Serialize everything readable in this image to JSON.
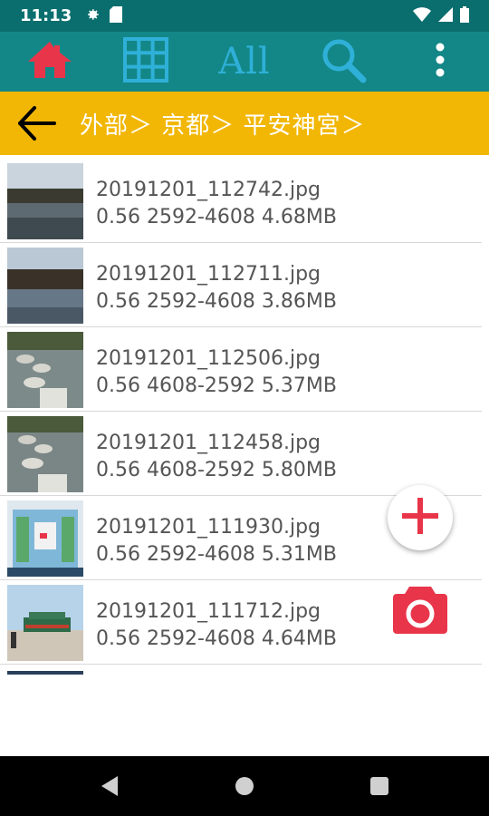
{
  "status": {
    "time": "11:13",
    "icons": [
      "gear-icon",
      "sd-card-icon",
      "wifi-icon",
      "signal-icon",
      "battery-icon"
    ]
  },
  "toolbar": {
    "home_icon": "home-icon",
    "grid_icon": "grid-icon",
    "all_label": "All",
    "search_icon": "search-icon",
    "menu_icon": "more-vert-icon"
  },
  "path": {
    "back_icon": "back-arrow-icon",
    "text": "外部＞ 京都＞ 平安神宮＞"
  },
  "files": [
    {
      "name": "20191201_112742.jpg",
      "info": "0.56 2592-4608  4.68MB"
    },
    {
      "name": "20191201_112711.jpg",
      "info": "0.56 2592-4608  3.86MB"
    },
    {
      "name": "20191201_112506.jpg",
      "info": "0.56 4608-2592  5.37MB"
    },
    {
      "name": "20191201_112458.jpg",
      "info": "0.56 4608-2592  5.80MB"
    },
    {
      "name": "20191201_111930.jpg",
      "info": "0.56 2592-4608  5.31MB"
    },
    {
      "name": "20191201_111712.jpg",
      "info": "0.56 2592-4608  4.64MB"
    }
  ],
  "fab": {
    "add_icon": "plus-icon",
    "camera_icon": "camera-icon"
  },
  "colors": {
    "status_bar": "#0a6e6e",
    "toolbar": "#138787",
    "path_bar": "#f2b705",
    "accent_red": "#e8354a",
    "accent_blue": "#2fb0d8"
  }
}
